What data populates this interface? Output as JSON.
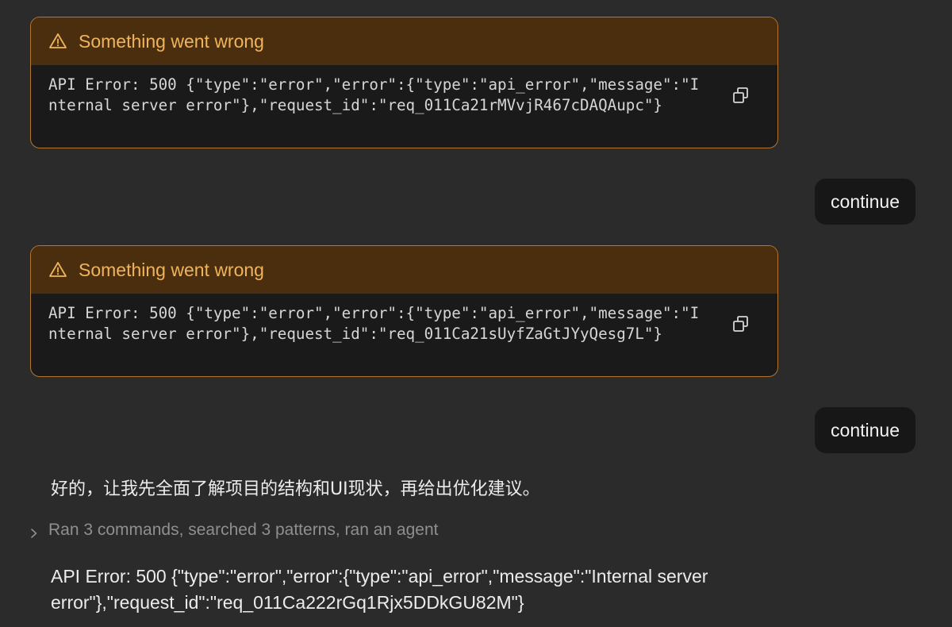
{
  "conversation": {
    "error_cards": [
      {
        "title": "Something went wrong",
        "message": "API Error: 500 {\"type\":\"error\",\"error\":{\"type\":\"api_error\",\"message\":\"Internal server error\"},\"request_id\":\"req_011Ca21rMVvjR467cDAQAupc\"}",
        "icon": "warning-icon",
        "copy_icon": "copy-icon"
      },
      {
        "title": "Something went wrong",
        "message": "API Error: 500 {\"type\":\"error\",\"error\":{\"type\":\"api_error\",\"message\":\"Internal server error\"},\"request_id\":\"req_011Ca21sUyfZaGtJYyQesg7L\"}",
        "icon": "warning-icon",
        "copy_icon": "copy-icon"
      }
    ],
    "user_messages": [
      {
        "text": "continue"
      },
      {
        "text": "continue"
      }
    ],
    "assistant_reply": "好的，让我先全面了解项目的结构和UI现状，再给出优化建议。",
    "tool_summary": {
      "text": "Ran 3 commands, searched 3 patterns, ran an agent",
      "icon": "chevron-right-icon"
    },
    "final_error": "API Error: 500 {\"type\":\"error\",\"error\":{\"type\":\"api_error\",\"message\":\"Internal server error\"},\"request_id\":\"req_011Ca222rGq1Rjx5DDkGU82M\"}"
  },
  "colors": {
    "background": "#2b2b2b",
    "error_border": "#b5772d",
    "error_header_bg": "#4a2e0e",
    "error_title": "#f0b45c",
    "user_bubble_bg": "#171717",
    "muted_text": "#8f8f8f"
  }
}
